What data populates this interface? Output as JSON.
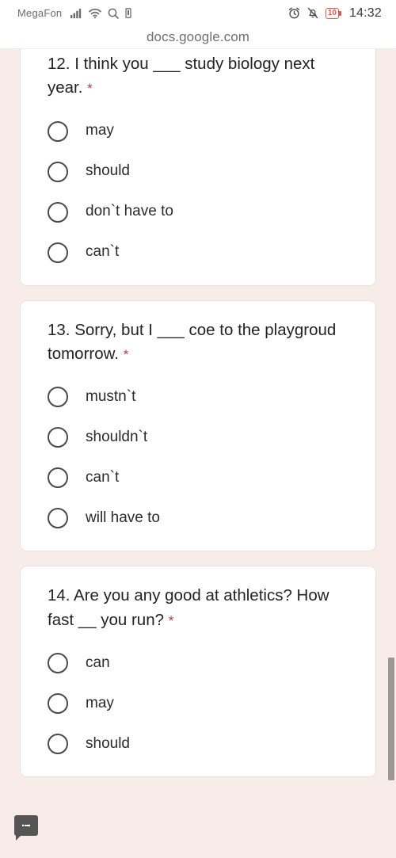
{
  "statusbar": {
    "carrier": "MegaFon",
    "icons": [
      "signal-bars-icon",
      "wifi-icon",
      "search-icon",
      "sim-card-icon"
    ],
    "right_icons": [
      "alarm-clock-icon",
      "mute-bell-icon"
    ],
    "battery_level": "10",
    "battery_color": "#e05b4f",
    "time": "14:32"
  },
  "browser": {
    "url": "docs.google.com"
  },
  "form": {
    "required_marker": "*",
    "questions": [
      {
        "text": "12. I think you ___ study biology next year.",
        "required": true,
        "options": [
          "may",
          "should",
          "don`t have to",
          "can`t"
        ]
      },
      {
        "text": "13. Sorry, but I ___ coe to the playgroud tomorrow.",
        "required": true,
        "options": [
          "mustn`t",
          "shouldn`t",
          "can`t",
          "will have to"
        ]
      },
      {
        "text": "14. Are you any good at athletics? How fast __ you run?",
        "required": true,
        "options": [
          "can",
          "may",
          "should"
        ]
      }
    ]
  },
  "feedback_button": {
    "glyph": "!",
    "name": "feedback-bubble"
  },
  "colors": {
    "page_background": "#f7ece8",
    "card_background": "#ffffff",
    "required_star": "#b33b3b",
    "scrollbar": "#9e9894"
  }
}
